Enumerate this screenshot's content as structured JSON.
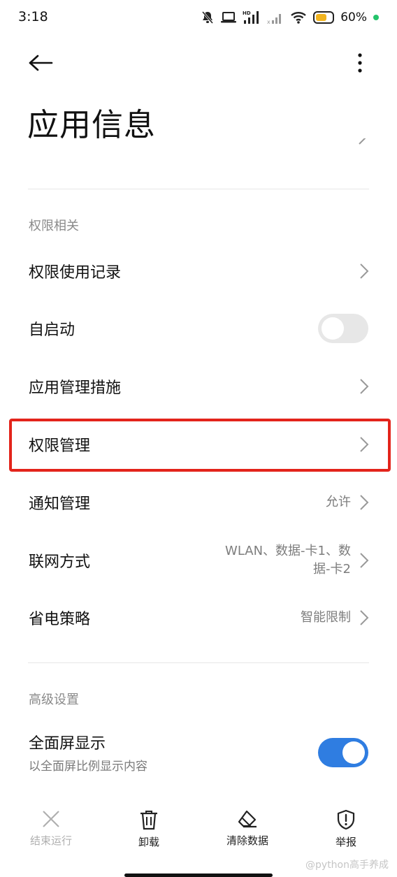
{
  "status_bar": {
    "time": "3:18",
    "battery_percent": "60%",
    "icons": [
      "mute-bell-icon",
      "laptop-icon",
      "hd-signal-icon",
      "signal-x-icon",
      "wifi-icon",
      "battery-icon",
      "charging-dot"
    ]
  },
  "header": {
    "back_icon": "back-arrow-icon",
    "more_icon": "more-vertical-icon",
    "title": "应用信息"
  },
  "permissions": {
    "header": "权限相关",
    "items": [
      {
        "label": "权限使用记录",
        "type": "chevron"
      },
      {
        "label": "自启动",
        "type": "toggle",
        "enabled": false
      },
      {
        "label": "应用管理措施",
        "type": "chevron"
      },
      {
        "label": "权限管理",
        "type": "chevron",
        "highlighted": true
      },
      {
        "label": "通知管理",
        "value": "允许",
        "type": "chevron"
      },
      {
        "label": "联网方式",
        "value_line1": "WLAN、数据-卡1、数",
        "value_line2": "据-卡2",
        "type": "chevron"
      },
      {
        "label": "省电策略",
        "value": "智能限制",
        "type": "chevron"
      }
    ]
  },
  "advanced": {
    "header": "高级设置",
    "fullscreen": {
      "label": "全面屏显示",
      "subtitle": "以全面屏比例显示内容",
      "enabled": true
    }
  },
  "bottom_bar": {
    "items": [
      {
        "label": "结束运行",
        "icon": "close-icon",
        "disabled": true
      },
      {
        "label": "卸载",
        "icon": "trash-icon"
      },
      {
        "label": "清除数据",
        "icon": "eraser-icon"
      },
      {
        "label": "举报",
        "icon": "shield-alert-icon"
      }
    ]
  },
  "watermark": "@python高手养成",
  "colors": {
    "accent": "#2f7de1",
    "highlight": "#e3241b",
    "battery": "#f1b420",
    "charging": "#24c36b"
  }
}
